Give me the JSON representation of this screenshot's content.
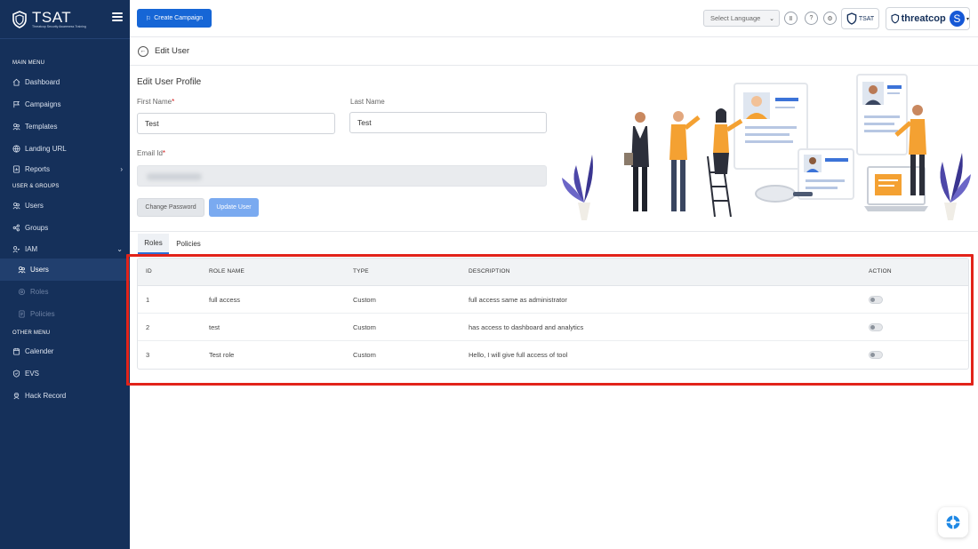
{
  "brand": {
    "name": "TSAT",
    "tagline": "Threatcop Security Awareness Training"
  },
  "sidebar": {
    "sections": [
      {
        "title": "MAIN MENU"
      },
      {
        "title": "USER & GROUPS"
      },
      {
        "title": "OTHER MENU"
      }
    ],
    "items": [
      {
        "label": "Dashboard",
        "icon": "home-icon"
      },
      {
        "label": "Campaigns",
        "icon": "flag-icon"
      },
      {
        "label": "Templates",
        "icon": "templates-icon"
      },
      {
        "label": "Landing URL",
        "icon": "globe-icon"
      },
      {
        "label": "Reports",
        "icon": "report-icon"
      },
      {
        "label": "Users",
        "icon": "users-icon"
      },
      {
        "label": "Groups",
        "icon": "groups-icon"
      },
      {
        "label": "IAM",
        "icon": "iam-icon"
      },
      {
        "label": "Users",
        "icon": "users-icon"
      },
      {
        "label": "Roles",
        "icon": "roles-icon"
      },
      {
        "label": "Policies",
        "icon": "policies-icon"
      },
      {
        "label": "Calender",
        "icon": "calendar-icon"
      },
      {
        "label": "EVS",
        "icon": "shield-icon"
      },
      {
        "label": "Hack Record",
        "icon": "hack-icon"
      }
    ]
  },
  "topbar": {
    "create_label": "Create Campaign",
    "language_placeholder": "Select Language",
    "tsat_badge": "TSAT",
    "threatcop_label": "threatcop",
    "avatar_initial": "S"
  },
  "page": {
    "title": "Edit User"
  },
  "form": {
    "title": "Edit User Profile",
    "first_name_label": "First Name",
    "first_name_value": "Test",
    "last_name_label": "Last Name",
    "last_name_value": "Test",
    "email_label": "Email Id",
    "required_mark": "*",
    "change_password_label": "Change Password",
    "update_user_label": "Update User"
  },
  "tabs": [
    {
      "label": "Roles",
      "active": true
    },
    {
      "label": "Policies",
      "active": false
    }
  ],
  "table": {
    "headers": {
      "id": "ID",
      "role": "ROLE NAME",
      "type": "TYPE",
      "desc": "DESCRIPTION",
      "action": "ACTION"
    },
    "rows": [
      {
        "id": "1",
        "role": "full access",
        "type": "Custom",
        "desc": "full access same as administrator",
        "enabled": false
      },
      {
        "id": "2",
        "role": "test",
        "type": "Custom",
        "desc": "has access to dashboard and analytics",
        "enabled": false
      },
      {
        "id": "3",
        "role": "Test role",
        "type": "Custom",
        "desc": "Hello, I will give full access of tool",
        "enabled": false
      }
    ]
  },
  "colors": {
    "sidebar": "#15305a",
    "primary": "#1666d6",
    "highlight": "#e2231a"
  }
}
